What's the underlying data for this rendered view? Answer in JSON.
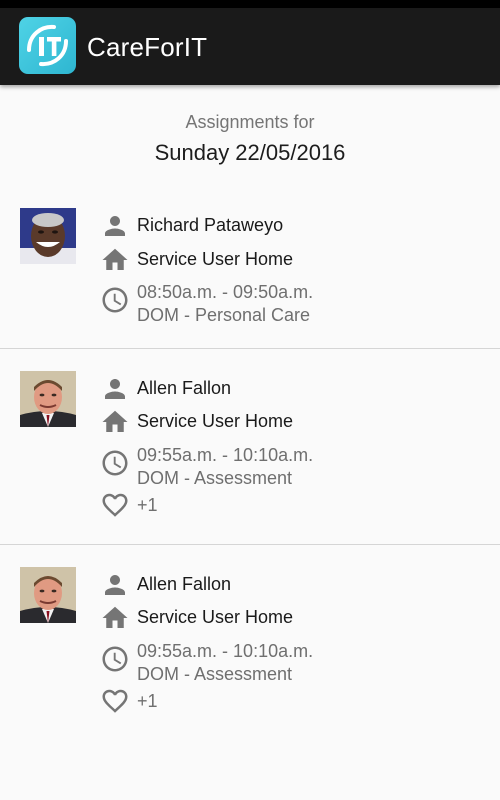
{
  "app": {
    "title": "CareForIT",
    "logo_text": "IT"
  },
  "header": {
    "subtitle": "Assignments for",
    "date": "Sunday 22/05/2016"
  },
  "assignments": [
    {
      "name": "Richard Pataweyo",
      "location": "Service User Home",
      "time": "08:50a.m. - 09:50a.m.",
      "service": "DOM - Personal Care",
      "extra": ""
    },
    {
      "name": "Allen Fallon",
      "location": "Service User Home",
      "time": "09:55a.m. - 10:10a.m.",
      "service": "DOM - Assessment",
      "extra": "+1"
    },
    {
      "name": "Allen Fallon",
      "location": "Service User Home",
      "time": "09:55a.m. - 10:10a.m.",
      "service": "DOM - Assessment",
      "extra": "+1"
    }
  ],
  "colors": {
    "appbar": "#1a1a1a",
    "logo": "#2eb6d1",
    "icon": "#757575"
  }
}
